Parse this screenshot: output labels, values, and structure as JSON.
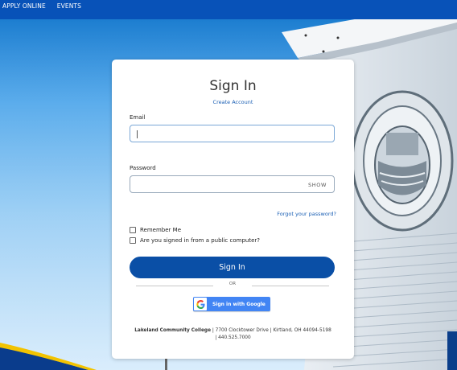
{
  "nav": {
    "items": [
      "APPLY ONLINE",
      "EVENTS"
    ]
  },
  "signin": {
    "title": "Sign In",
    "create_account": "Create Account",
    "email_label": "Email",
    "email_value": "",
    "password_label": "Password",
    "password_value": "",
    "show_label": "SHOW",
    "forgot_link": "Forgot your password?",
    "remember_me": "Remember Me",
    "public_computer": "Are you signed in from a public computer?",
    "submit_label": "Sign In",
    "or_label": "OR",
    "google_label": "Sign in with Google"
  },
  "footer": {
    "college_name": "Lakeland Community College",
    "address": " | 7700 Clocktower Drive | Kirtland, OH 44094-5198",
    "phone": "| 440.525.7000"
  },
  "colors": {
    "topbar": "#0852b8",
    "primary_button": "#0a4fa6",
    "link": "#1a5fb4",
    "google_blue": "#4285f4"
  }
}
